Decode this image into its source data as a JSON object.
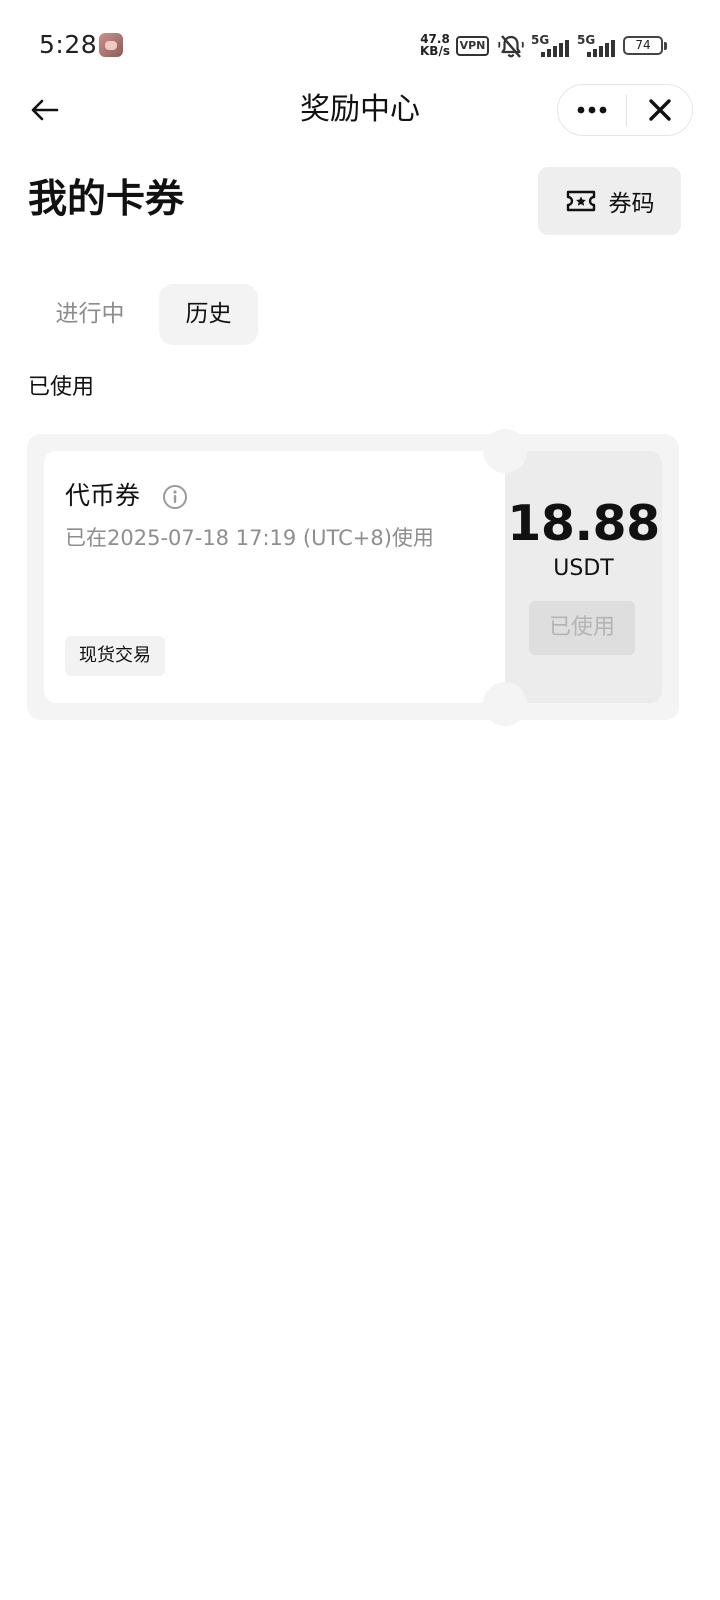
{
  "status_bar": {
    "time": "5:28",
    "net_speed_value": "47.8",
    "net_speed_unit": "KB/s",
    "vpn_label": "VPN",
    "signal1_label": "5G",
    "signal2_label": "5G",
    "battery": "74"
  },
  "nav": {
    "title": "奖励中心",
    "back_icon": "arrow-left-icon",
    "more_icon": "more-horizontal-icon",
    "close_icon": "close-icon"
  },
  "header": {
    "title": "我的卡券",
    "code_button_label": "券码",
    "code_icon": "ticket-star-icon"
  },
  "tabs": [
    {
      "label": "进行中",
      "active": false
    },
    {
      "label": "历史",
      "active": true
    }
  ],
  "section_label": "已使用",
  "coupon": {
    "name": "代币券",
    "used_at": "已在2025-07-18 17:19 (UTC+8)使用",
    "tag": "现货交易",
    "amount": "18.88",
    "currency": "USDT",
    "status_button": "已使用"
  }
}
